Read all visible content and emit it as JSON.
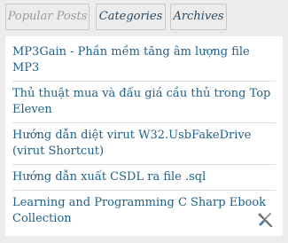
{
  "tabs": [
    {
      "label": "Popular Posts",
      "active": true
    },
    {
      "label": "Categories",
      "active": false
    },
    {
      "label": "Archives",
      "active": false
    }
  ],
  "posts": [
    {
      "title": "MP3Gain - Phần mềm tăng âm lượng file MP3"
    },
    {
      "title": "Thủ thuật mua và đấu giá cầu thủ trong Top Eleven"
    },
    {
      "title": "Hướng dẫn diệt virut W32.UsbFakeDrive (virut Shortcut)"
    },
    {
      "title": "Hướng dẫn xuất CSDL ra file .sql"
    },
    {
      "title": "Learning and Programming C Sharp Ebook Collection"
    }
  ],
  "icons": {
    "tools": "tools-icon"
  },
  "colors": {
    "background": "#ececec",
    "panel": "#ffffff",
    "link": "#1e5f86",
    "tab_text": "#2b4a63",
    "tab_active_text": "#9a9a9a"
  }
}
